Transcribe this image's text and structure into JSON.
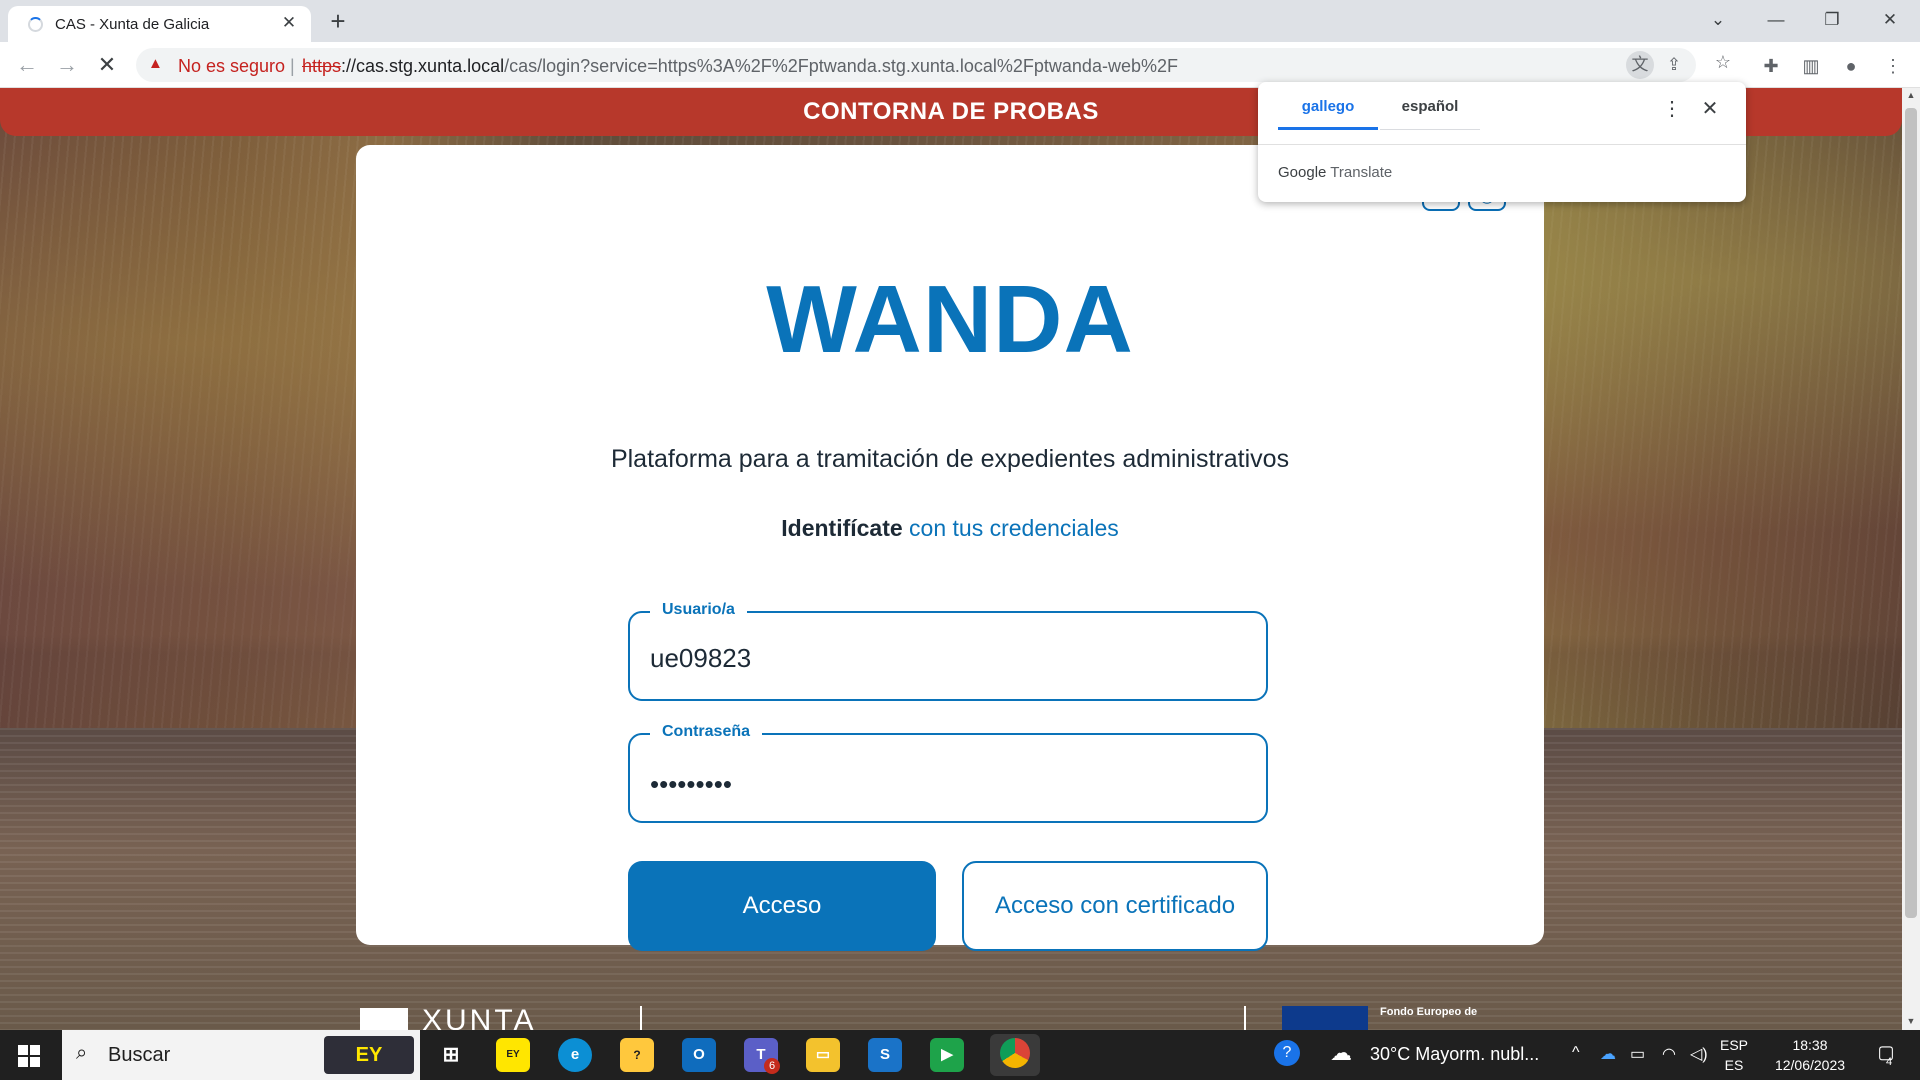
{
  "browser": {
    "tab_title": "CAS - Xunta de Galicia",
    "tab_close": "✕",
    "new_tab": "+",
    "not_secure": "No es seguro",
    "separator": "|",
    "url_scheme": "https",
    "url_host": "://cas.stg.xunta.local",
    "url_path": "/cas/login?service=https%3A%2F%2Fptwanda.stg.xunta.local%2Fptwanda-web%2F",
    "window_controls": {
      "chevron": "⌄",
      "minimize": "—",
      "restore": "❐",
      "close": "✕"
    }
  },
  "translate_popup": {
    "tab_active": "gallego",
    "tab_other": "español",
    "brand_google": "Google",
    "brand_translate": "Translate"
  },
  "page": {
    "banner": "CONTORNA DE PROBAS",
    "logo": "WANDA",
    "subtitle": "Plataforma para a tramitación de expedientes administrativos",
    "ident_bold": "Identifícate",
    "ident_rest": " con tus credenciales",
    "username": {
      "label": "Usuario/a",
      "value": "ue09823"
    },
    "password": {
      "label": "Contraseña",
      "value": "•••••••••"
    },
    "login_button": "Acceso",
    "cert_button": "Acceso con certificado",
    "footer_xunta": "XUNTA",
    "footer_eu": "Fondo Europeo de"
  },
  "taskbar": {
    "search_placeholder": "Buscar",
    "ey": "EY",
    "weather": "30°C  Mayorm. nubl...",
    "lang_top": "ESP",
    "lang_bottom": "ES",
    "time": "18:38",
    "date": "12/06/2023",
    "notif_count": "4",
    "teams_badge": "6"
  },
  "colors": {
    "brand_blue": "#0a73b9",
    "banner_red": "#b7382b",
    "warning_red": "#c5221f",
    "google_blue": "#1a73e8"
  },
  "icons": [
    "back-arrow-icon",
    "forward-arrow-icon",
    "stop-loading-icon",
    "warning-icon",
    "translate-icon",
    "share-icon",
    "star-icon",
    "extensions-icon",
    "side-panel-icon",
    "profile-icon",
    "menu-dots-icon",
    "windows-start-icon",
    "search-icon",
    "task-view-icon",
    "edge-icon",
    "outlook-icon",
    "teams-icon",
    "file-explorer-icon",
    "chrome-icon",
    "weather-icon",
    "help-icon",
    "onedrive-icon",
    "battery-icon",
    "wifi-icon",
    "volume-icon",
    "notification-icon"
  ]
}
